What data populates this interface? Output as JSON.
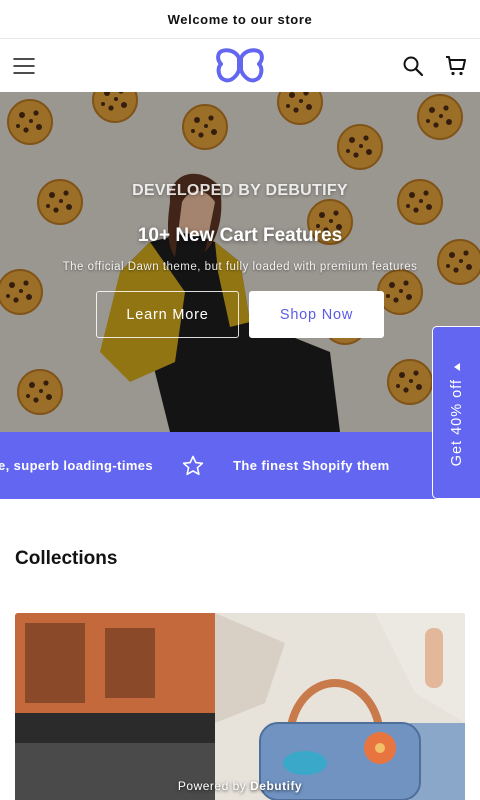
{
  "announcement": {
    "text": "Welcome to our store"
  },
  "header": {
    "menu_icon": "hamburger-menu-icon",
    "logo": "butterfly-logo",
    "search_icon": "search-icon",
    "cart_icon": "cart-icon"
  },
  "hero": {
    "eyebrow": "DEVELOPED BY DEBUTIFY",
    "title": "10+ New Cart Features",
    "subtitle": "The official Dawn theme, but fully loaded with premium features",
    "primary_button": "Learn More",
    "secondary_button": "Shop Now"
  },
  "marquee": {
    "items": [
      "nance, superb loading-times",
      "The finest Shopify them"
    ],
    "separator_icon": "star-outline-icon",
    "background": "#6266f0"
  },
  "side_tab": {
    "label": "Get 40% off",
    "icon": "caret-left-icon"
  },
  "collections": {
    "heading": "Collections"
  },
  "footer": {
    "powered_prefix": "Powered by",
    "powered_brand": "Debutify"
  },
  "colors": {
    "accent": "#6266f0",
    "text": "#121212",
    "background": "#ffffff"
  }
}
